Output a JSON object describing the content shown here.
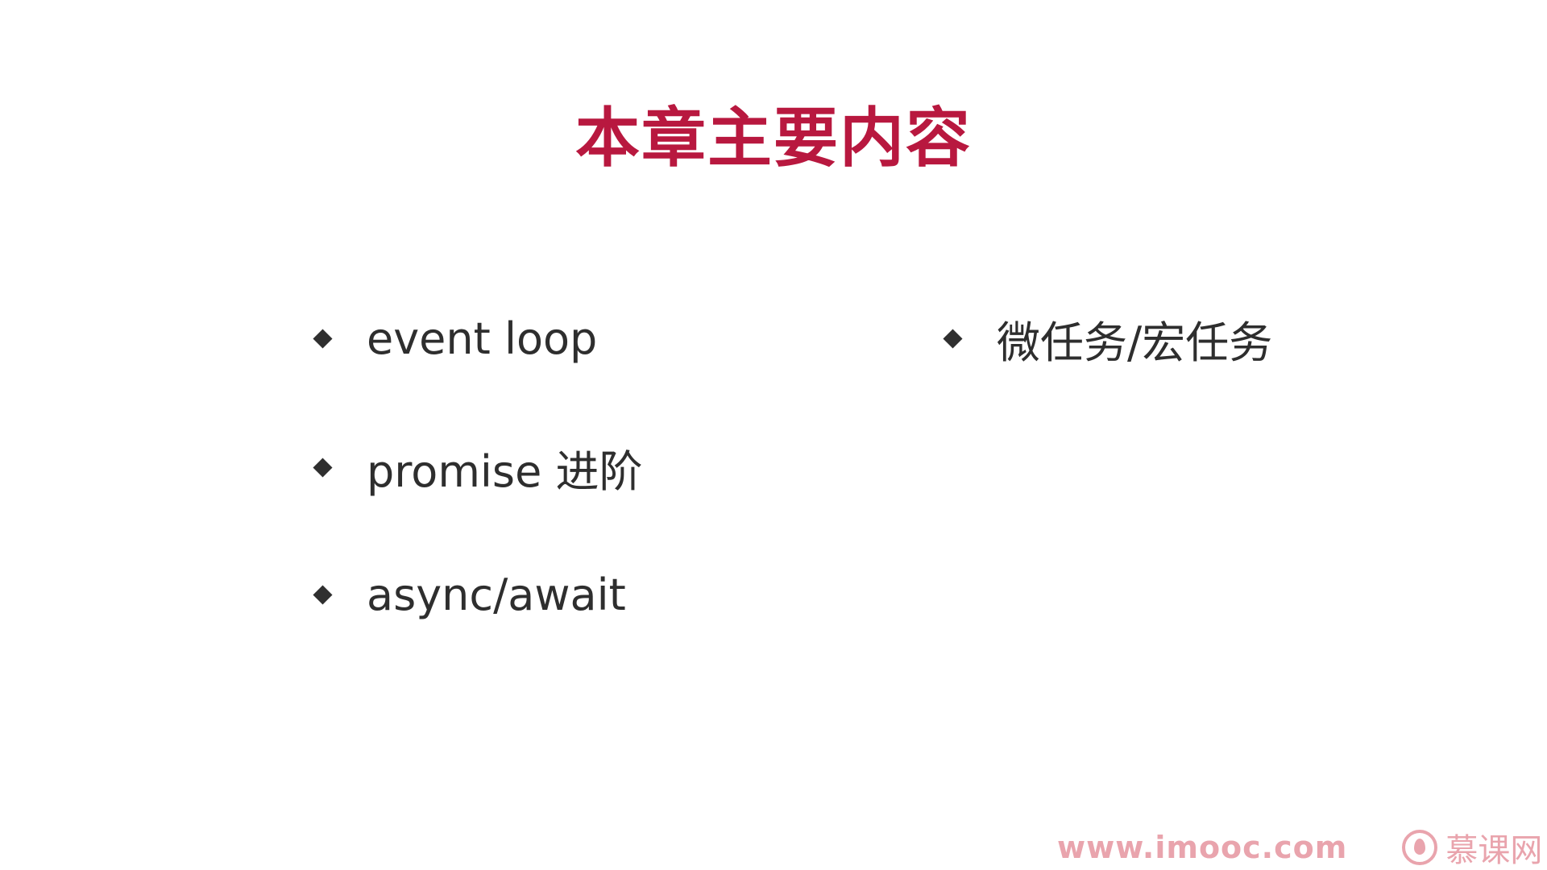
{
  "slide": {
    "title": "本章主要内容",
    "bullets": [
      {
        "label": "event loop"
      },
      {
        "label": "promise 进阶"
      },
      {
        "label": "async/await"
      },
      {
        "label": "微任务/宏任务"
      }
    ]
  },
  "watermark": {
    "url": "www.imooc.com",
    "brand": "慕课网",
    "icon": "flame-logo-icon"
  },
  "colors": {
    "title": "#b8183f",
    "text": "#2e2e2e",
    "bullet": "#2f2f2f",
    "watermark": "#e9a4ad",
    "background": "#ffffff"
  }
}
